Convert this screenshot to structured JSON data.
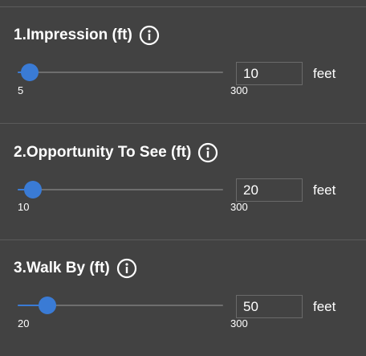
{
  "colors": {
    "background": "#424242",
    "divider": "#5b5b5b",
    "accent": "#3a7bd5",
    "track": "#6e6e6e"
  },
  "sections": [
    {
      "title": "1.Impression (ft)",
      "info_icon": "info-circle-icon",
      "slider": {
        "min": 5,
        "max": 300,
        "value": 10,
        "min_label": "5",
        "max_label": "300"
      },
      "input_value": "10",
      "unit": "feet"
    },
    {
      "title": "2.Opportunity To See (ft)",
      "info_icon": "info-circle-icon",
      "slider": {
        "min": 10,
        "max": 300,
        "value": 20,
        "min_label": "10",
        "max_label": "300"
      },
      "input_value": "20",
      "unit": "feet"
    },
    {
      "title": "3.Walk By (ft)",
      "info_icon": "info-circle-icon",
      "slider": {
        "min": 20,
        "max": 300,
        "value": 50,
        "min_label": "20",
        "max_label": "300"
      },
      "input_value": "50",
      "unit": "feet"
    }
  ]
}
